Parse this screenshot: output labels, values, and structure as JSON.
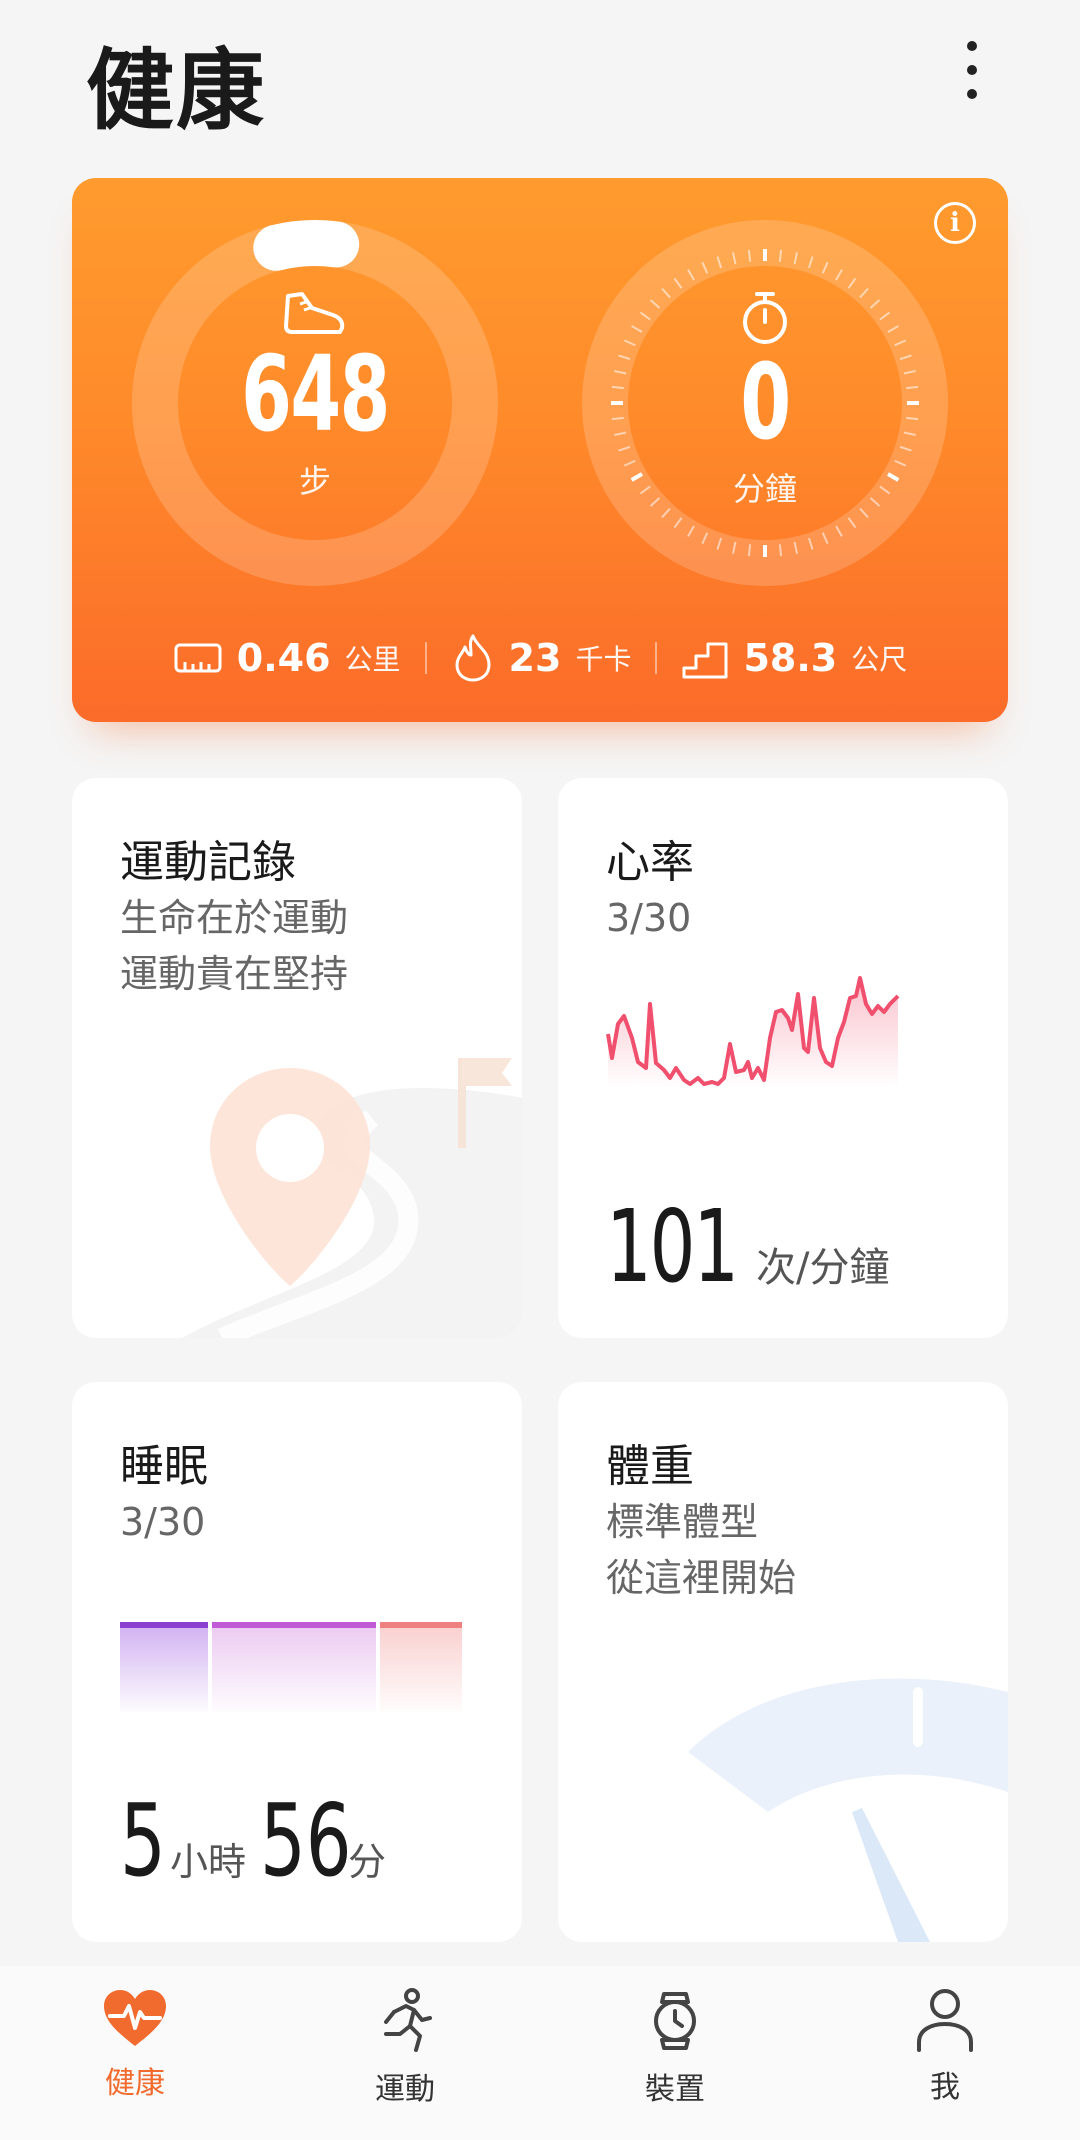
{
  "header": {
    "title": "健康"
  },
  "summary": {
    "steps": {
      "value": "648",
      "unit": "步",
      "progress": 0.06
    },
    "active_minutes": {
      "value": "0",
      "unit": "分鐘"
    },
    "stats": [
      {
        "icon": "ruler-icon",
        "value": "0.46",
        "unit": "公里"
      },
      {
        "icon": "flame-icon",
        "value": "23",
        "unit": "千卡"
      },
      {
        "icon": "stairs-icon",
        "value": "58.3",
        "unit": "公尺"
      }
    ]
  },
  "cards": {
    "exercise": {
      "title": "運動記錄",
      "line1": "生命在於運動",
      "line2": "運動貴在堅持"
    },
    "heart_rate": {
      "title": "心率",
      "date": "3/30",
      "value": "101",
      "unit": "次/分鐘"
    },
    "sleep": {
      "title": "睡眠",
      "date": "3/30",
      "hours": "5",
      "hours_unit": "小時",
      "minutes": "56",
      "minutes_unit": "分"
    },
    "weight": {
      "title": "體重",
      "line1": "標準體型",
      "line2": "從這裡開始"
    }
  },
  "nav": [
    {
      "label": "健康",
      "icon": "heart-pulse-icon",
      "active": true
    },
    {
      "label": "運動",
      "icon": "runner-icon",
      "active": false
    },
    {
      "label": "裝置",
      "icon": "watch-icon",
      "active": false
    },
    {
      "label": "我",
      "icon": "person-icon",
      "active": false
    }
  ],
  "colors": {
    "accent": "#f26b2e",
    "hero_top": "#ff9b2e",
    "hero_bottom": "#fb6b2a",
    "heart_line": "#f0506e"
  }
}
